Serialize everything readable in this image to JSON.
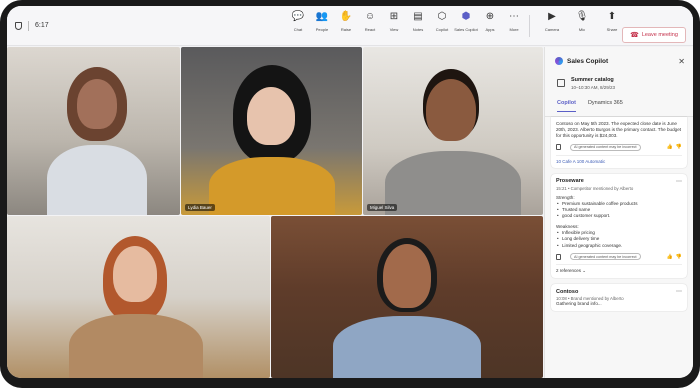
{
  "meeting_bar": {
    "timer": "6:17",
    "tools": [
      {
        "label": "Chat",
        "icon": "chat-icon",
        "glyph": "💬"
      },
      {
        "label": "People",
        "icon": "people-icon",
        "glyph": "👥"
      },
      {
        "label": "Raise",
        "icon": "raise-hand-icon",
        "glyph": "✋"
      },
      {
        "label": "React",
        "icon": "react-icon",
        "glyph": "☺"
      },
      {
        "label": "View",
        "icon": "view-icon",
        "glyph": "⊞"
      },
      {
        "label": "Notes",
        "icon": "notes-icon",
        "glyph": "▤"
      },
      {
        "label": "Copilot",
        "icon": "copilot-icon",
        "glyph": "⬡"
      },
      {
        "label": "Sales Copilot",
        "icon": "sales-copilot-icon",
        "glyph": "⬢"
      },
      {
        "label": "Apps",
        "icon": "apps-icon",
        "glyph": "⊕"
      },
      {
        "label": "More",
        "icon": "more-icon",
        "glyph": "⋯"
      }
    ],
    "camera_label": "Camera",
    "mic_label": "Mic",
    "share_label": "Share",
    "leave_label": "Leave meeting"
  },
  "participants": [
    {
      "name": ""
    },
    {
      "name": "Lydia Bauer"
    },
    {
      "name": "Miguel Silva"
    },
    {
      "name": ""
    },
    {
      "name": ""
    }
  ],
  "panel": {
    "title": "Sales Copilot",
    "meeting_title": "Summer catalog",
    "meeting_time": "10–10:30 AM, 8/29/23",
    "tabs": [
      "Copilot",
      "Dynamics 365"
    ],
    "card1": {
      "text": "Contoso on May 5th 2023. The expected close date is June 20th, 2023. Alberto Burgos is the primary contact. The budget for this opportunity is $24,003.",
      "disclaimer": "AI generated content may be incorrect",
      "link": "10 Cafe A 100 Automatic"
    },
    "card2": {
      "title": "Proseware",
      "subtitle": "15:21 • Competitor mentioned by Alberto",
      "strength_label": "Strength:",
      "strengths": [
        "Premium sustainable coffee products",
        "Trusted name",
        "good customer support."
      ],
      "weakness_label": "Weakness:",
      "weaknesses": [
        "Inflexible pricing",
        "Long delivery time",
        "Limited geographic coverage."
      ],
      "disclaimer": "AI generated content may be incorrect",
      "references": "2 references"
    },
    "card3": {
      "title": "Contoso",
      "subtitle": "10:08 • Brand mentioned by Alberto",
      "text": "Gathering brand info..."
    }
  },
  "colors": {
    "accent": "#5b5fc7",
    "leave": "#c4314b"
  }
}
